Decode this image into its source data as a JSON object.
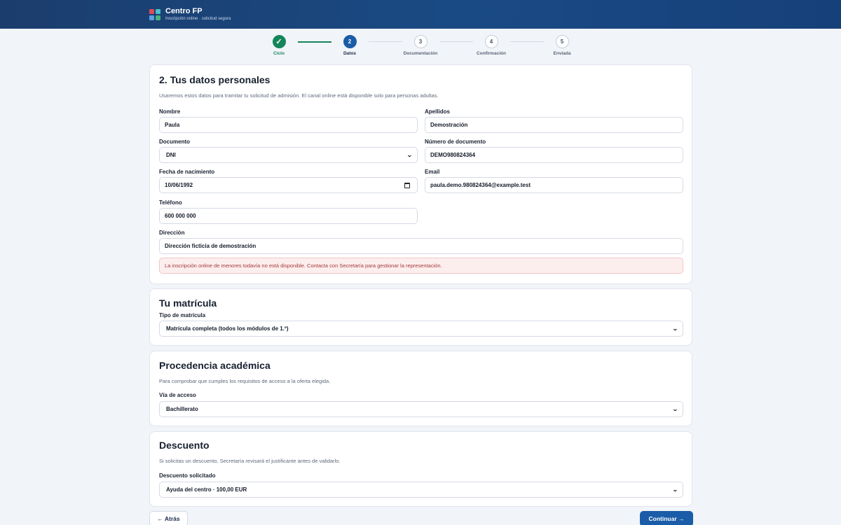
{
  "header": {
    "brand_title": "Centro FP",
    "brand_subtitle": "Inscripción online · solicitud segura",
    "logo_colors": [
      "#e24a5a",
      "#4bc0c8",
      "#5aa0e6",
      "#4ab37a"
    ]
  },
  "stepper": {
    "steps": [
      {
        "number": "✓",
        "label": "Ciclo",
        "state": "done"
      },
      {
        "number": "2",
        "label": "Datos",
        "state": "active"
      },
      {
        "number": "3",
        "label": "Documentación",
        "state": "pending"
      },
      {
        "number": "4",
        "label": "Confirmación",
        "state": "pending"
      },
      {
        "number": "5",
        "label": "Enviada",
        "state": "pending"
      }
    ]
  },
  "personal": {
    "title": "2. Tus datos personales",
    "description": "Usaremos estos datos para tramitar tu solicitud de admisión. El canal online está disponible solo para personas adultas.",
    "nombre_label": "Nombre",
    "nombre_value": "Paula",
    "apellidos_label": "Apellidos",
    "apellidos_value": "Demostración",
    "documento_label": "Documento",
    "documento_value": "DNI",
    "numdoc_label": "Número de documento",
    "numdoc_value": "DEMO980824364",
    "fecha_label": "Fecha de nacimiento",
    "fecha_value": "10/06/1992",
    "email_label": "Email",
    "email_value": "paula.demo.980824364@example.test",
    "telefono_label": "Teléfono",
    "telefono_value": "600 000 000",
    "direccion_label": "Dirección",
    "direccion_value": "Dirección ficticia de demostración",
    "alert": "La inscripción online de menores todavía no está disponible. Contacta con Secretaría para gestionar la representación."
  },
  "matricula": {
    "title": "Tu matrícula",
    "tipo_label": "Tipo de matrícula",
    "tipo_value": "Matrícula completa (todos los módulos de 1.º)"
  },
  "procedencia": {
    "title": "Procedencia académica",
    "description": "Para comprobar que cumples los requisitos de acceso a la oferta elegida.",
    "via_label": "Vía de acceso",
    "via_value": "Bachillerato"
  },
  "descuento": {
    "title": "Descuento",
    "description": "Si solicitas un descuento, Secretaría revisará el justificante antes de validarlo.",
    "label": "Descuento solicitado",
    "value": "Ayuda del centro · 100,00 EUR"
  },
  "actions": {
    "back_label": "← Atrás",
    "next_label": "Continuar →"
  },
  "colors": {
    "primary": "#1a5ca8",
    "success": "#14865a",
    "alert_text": "#a33a3a"
  }
}
